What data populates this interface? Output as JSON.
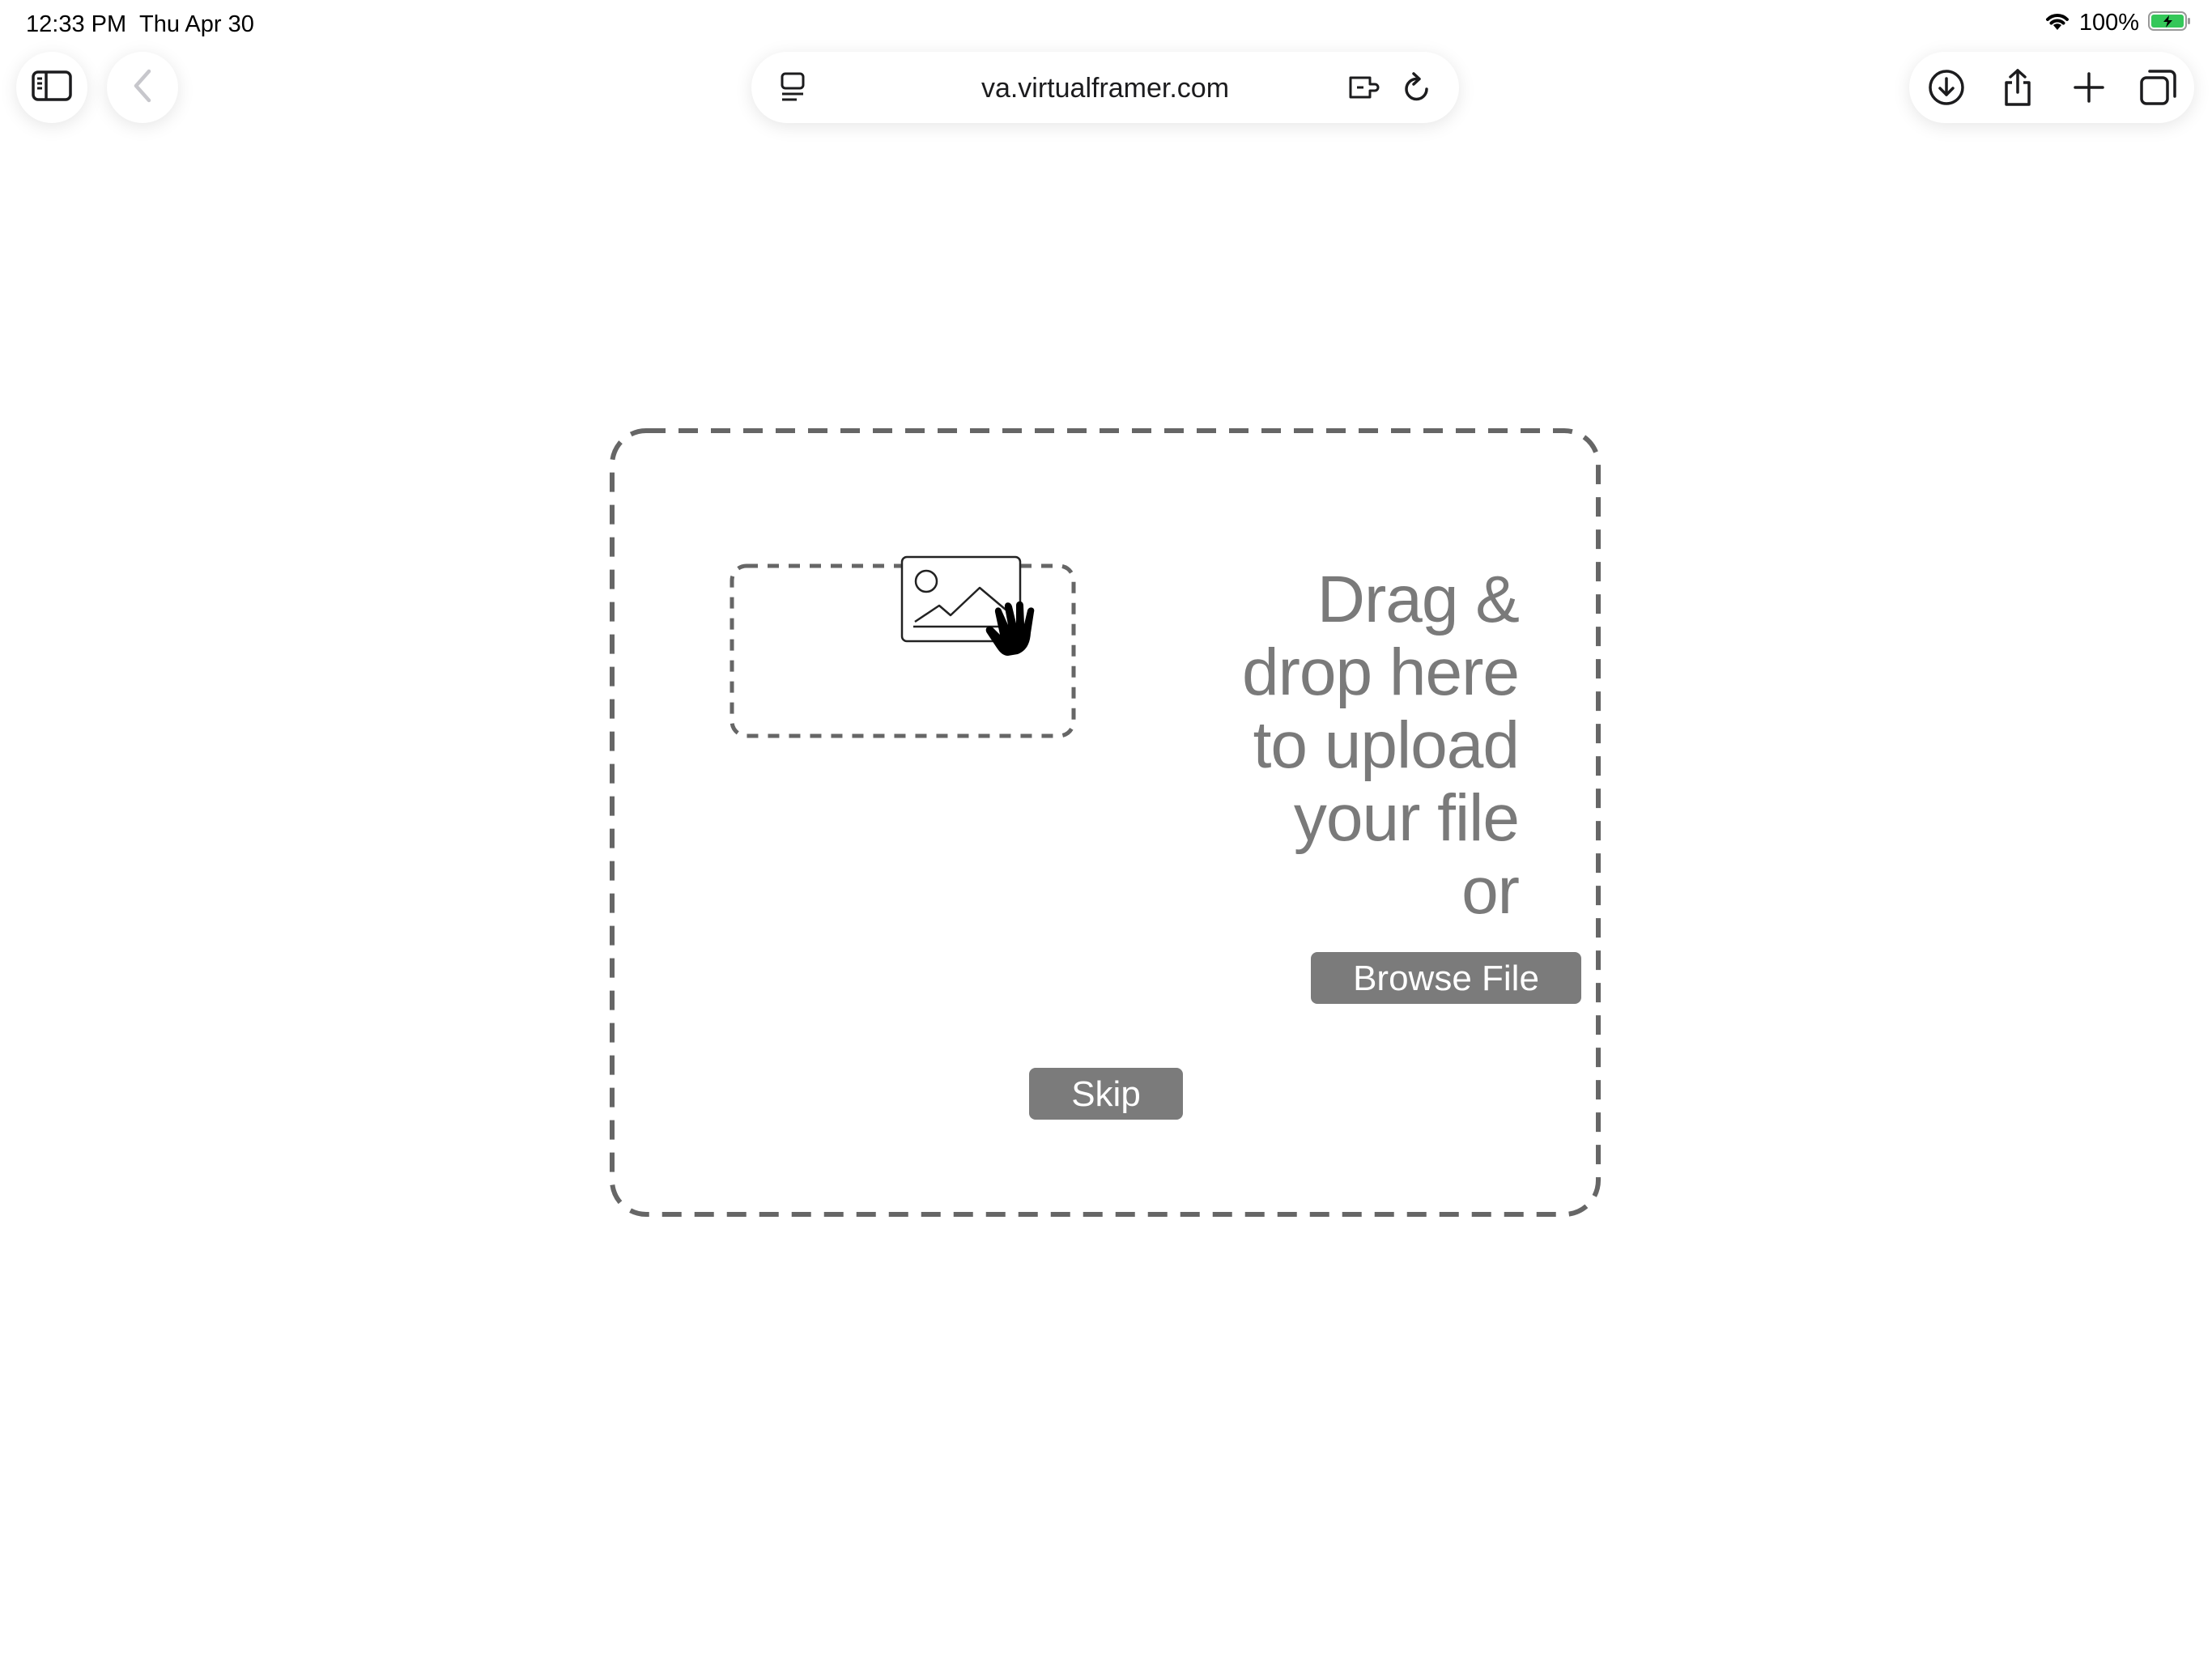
{
  "status_bar": {
    "time": "12:33 PM",
    "date": "Thu Apr 30",
    "battery_percent": "100%",
    "icons": [
      "wifi-icon",
      "battery-charging-icon"
    ]
  },
  "browser": {
    "url": "va.virtualframer.com",
    "left_buttons": [
      "sidebar-icon",
      "back-chevron-icon"
    ],
    "url_icons": [
      "reader-icon",
      "extension-icon",
      "reload-icon"
    ],
    "right_buttons": [
      "download-icon",
      "share-icon",
      "new-tab-icon",
      "tabs-icon"
    ]
  },
  "upload": {
    "instruction_lines": [
      "Drag &",
      "drop here",
      "to upload",
      "your file",
      "or"
    ],
    "browse_label": "Browse File",
    "skip_label": "Skip",
    "illustration_icons": [
      "image-icon",
      "hand-pointer-icon"
    ]
  },
  "colors": {
    "text_gray": "#7a7a7a",
    "button_gray": "#7b7b7b",
    "dash_gray": "#666666",
    "background": "#ffffff"
  }
}
